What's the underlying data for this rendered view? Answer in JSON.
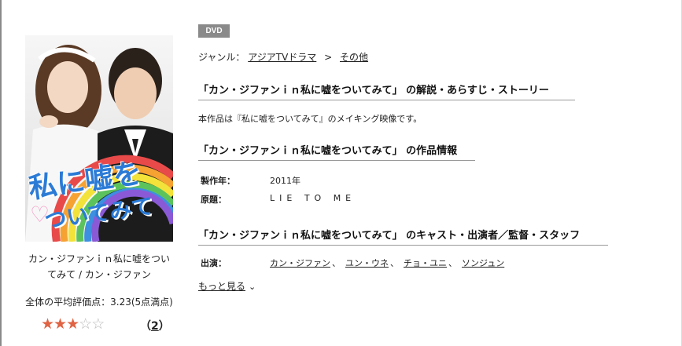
{
  "product": {
    "badge": "DVD",
    "cover": {
      "title_art_line1": "私に嘘を",
      "title_art_line2": "ついてみて",
      "heart_icon": "heart-icon"
    },
    "title_line1": "カン・ジファンｉｎ私に嘘をつい",
    "title_line2": "てみて / カン・ジファン",
    "rating_label": "全体の平均評価点：3.23(5点満点)",
    "rating_value": 3.23,
    "rating_max": 5,
    "review_count_open": "（",
    "review_count": "2",
    "review_count_close": "）"
  },
  "genre": {
    "label": "ジャンル：",
    "items": [
      "アジアTVドラマ",
      "その他"
    ],
    "separator": ">"
  },
  "sections": {
    "story_heading": "「カン・ジファンｉｎ私に嘘をついてみて」 の解説・あらすじ・ストーリー",
    "story_text": "本作品は『私に嘘をついてみて』のメイキング映像です。",
    "info_heading": "「カン・ジファンｉｎ私に嘘をついてみて」 の作品情報",
    "cast_heading": "「カン・ジファンｉｎ私に嘘をついてみて」 のキャスト・出演者／監督・スタッフ"
  },
  "info": {
    "year_label": "製作年：",
    "year_value": "2011年",
    "original_label": "原題：",
    "original_value": "LIE TO ME"
  },
  "cast": {
    "label": "出演：",
    "members": [
      "カン・ジファン",
      "ユン・ウネ",
      "チョ・ユニ",
      "ソンジュン"
    ],
    "separator": "、"
  },
  "more": {
    "label": "もっと見る",
    "icon": "chevron-down-icon"
  },
  "colors": {
    "star_fill": "#e06444",
    "badge_bg": "#8a8a8a",
    "title_art": "#2b7bd6"
  }
}
